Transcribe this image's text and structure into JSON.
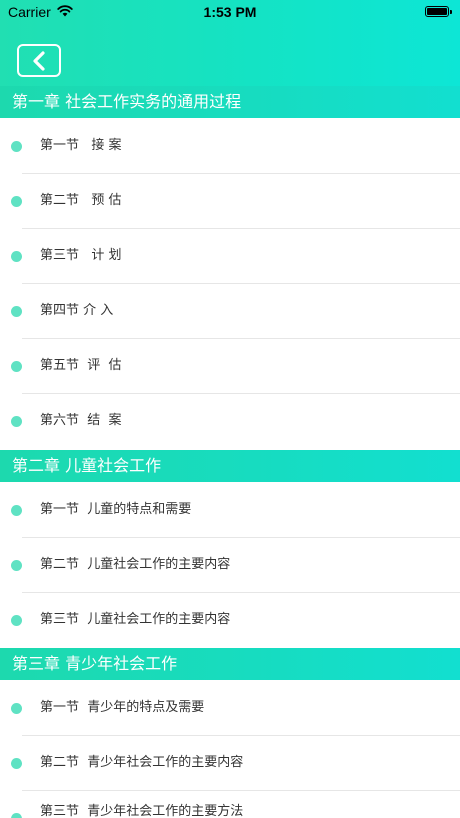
{
  "status_bar": {
    "carrier": "Carrier",
    "time": "1:53 PM"
  },
  "colors": {
    "accent": "#1ddcb8",
    "dot": "#5fe2c3",
    "text": "#333333"
  },
  "sections": [
    {
      "title": "第一章 社会工作实务的通用过程",
      "items": [
        "第一节   接 案",
        "第二节   预 估",
        "第三节   计 划",
        "第四节 介 入",
        "第五节  评  估",
        "第六节  结  案"
      ]
    },
    {
      "title": "第二章 儿童社会工作",
      "items": [
        "第一节  儿童的特点和需要",
        "第二节  儿童社会工作的主要内容",
        "第三节  儿童社会工作的主要内容"
      ]
    },
    {
      "title": "第三章 青少年社会工作",
      "items": [
        "第一节  青少年的特点及需要",
        "第二节  青少年社会工作的主要内容",
        "第三节  青少年社会工作的主要方法"
      ]
    }
  ]
}
